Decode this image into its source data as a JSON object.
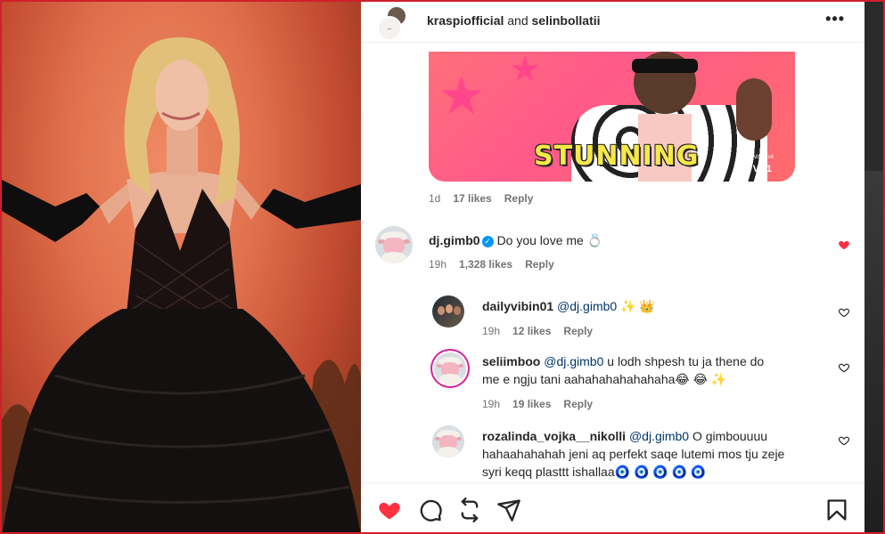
{
  "post": {
    "header": {
      "user1": "kraspiofficial",
      "conjunction": " and ",
      "user2": "selinbollatii",
      "more_label": "•••"
    }
  },
  "gif": {
    "caption": "STUNNING",
    "network": "VH1",
    "hashtag": "#AllStars4"
  },
  "reply_meta": {
    "age": "1d",
    "likes": "17 likes",
    "reply_label": "Reply"
  },
  "comments": [
    {
      "username": "dj.gimb0",
      "verified": true,
      "text": "Do you love me 💍",
      "age": "19h",
      "likes": "1,328 likes",
      "reply_label": "Reply",
      "liked": true
    }
  ],
  "replies": [
    {
      "username": "dailyvibin01",
      "mention": "@dj.gimb0",
      "text": " ✨ 👑",
      "age": "19h",
      "likes": "12 likes",
      "reply_label": "Reply"
    },
    {
      "username": "seliimboo",
      "mention": "@dj.gimb0",
      "text_line1": " u lodh shpesh tu ja thene do",
      "text_line2": "me e ngju tani aahahahahahahaha😂 😂 ✨",
      "age": "19h",
      "likes": "19 likes",
      "reply_label": "Reply"
    },
    {
      "username": "rozalinda_vojka__nikolli",
      "mention": "@dj.gimb0",
      "text_line1": " O gimbouuuu",
      "text_line2": "hahaahahahah jeni aq perfekt saqe lutemi mos tju zeje",
      "text_line3": "syri keqq plasttt ishallaa🧿 🧿 🧿 🧿 🧿"
    }
  ],
  "actions": {
    "like_icon": "heart-filled-icon",
    "comment_icon": "comment-icon",
    "repost_icon": "repost-icon",
    "share_icon": "share-icon",
    "save_icon": "bookmark-icon"
  },
  "colors": {
    "like_red": "#ff3040",
    "link_blue": "#00376b",
    "verified_blue": "#0095f6",
    "frame_red": "#d0202a"
  }
}
